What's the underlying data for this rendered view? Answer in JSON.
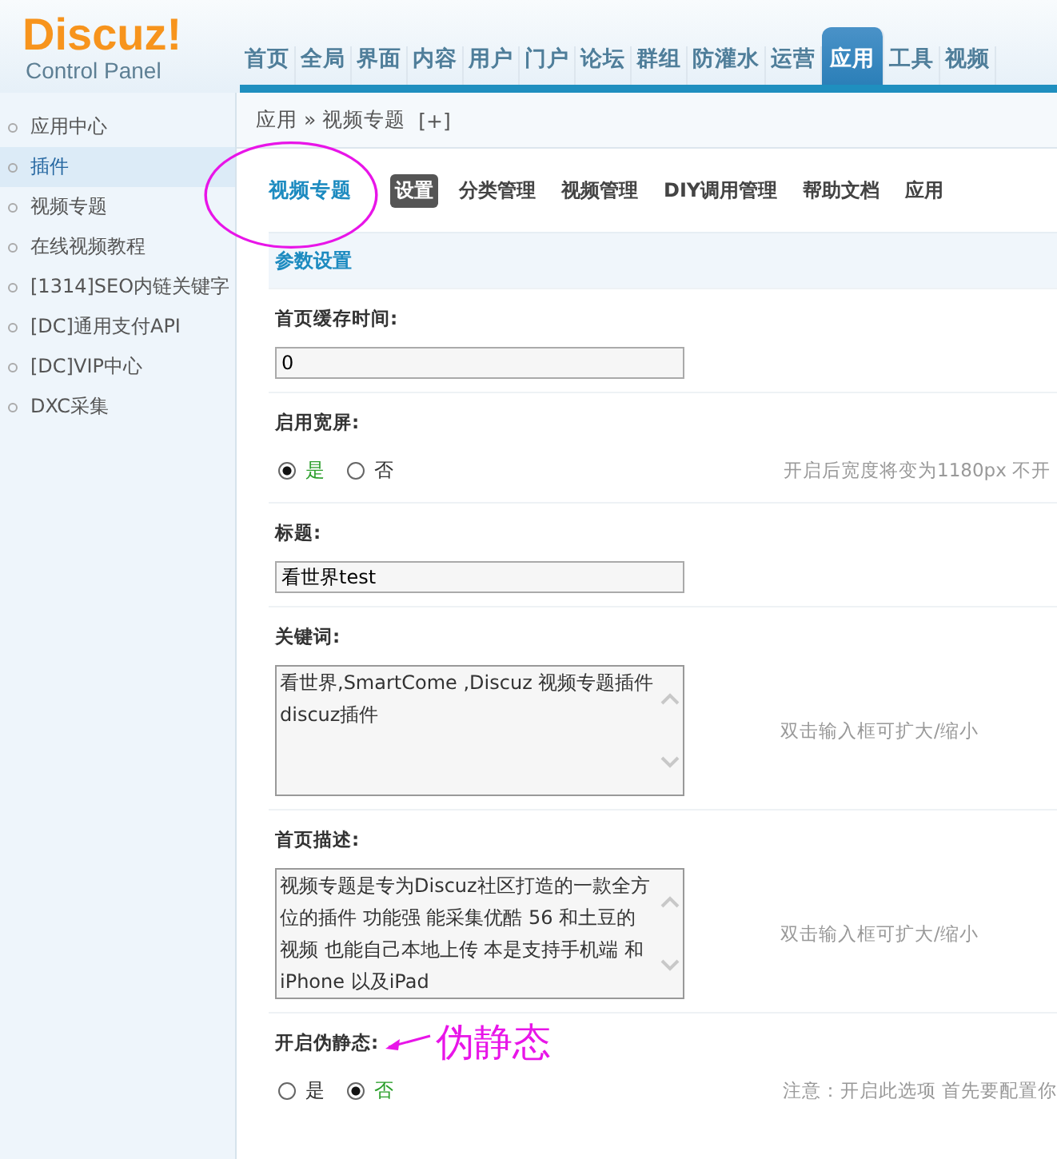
{
  "logo": {
    "title": "Discuz!",
    "subtitle": "Control Panel"
  },
  "nav": [
    {
      "label": "首页",
      "selected": false
    },
    {
      "label": "全局",
      "selected": false
    },
    {
      "label": "界面",
      "selected": false
    },
    {
      "label": "内容",
      "selected": false
    },
    {
      "label": "用户",
      "selected": false
    },
    {
      "label": "门户",
      "selected": false
    },
    {
      "label": "论坛",
      "selected": false
    },
    {
      "label": "群组",
      "selected": false
    },
    {
      "label": "防灌水",
      "selected": false
    },
    {
      "label": "运营",
      "selected": false
    },
    {
      "label": "应用",
      "selected": true
    },
    {
      "label": "工具",
      "selected": false
    },
    {
      "label": "视频",
      "selected": false
    }
  ],
  "breadcrumb": {
    "path": "应用 » 视频专题",
    "add": "[+]"
  },
  "sidebar": {
    "items": [
      {
        "label": "应用中心",
        "selected": false
      },
      {
        "label": "插件",
        "selected": true
      },
      {
        "label": "视频专题",
        "selected": false
      },
      {
        "label": "在线视频教程",
        "selected": false
      },
      {
        "label": "[1314]SEO内链关键字",
        "selected": false
      },
      {
        "label": "[DC]通用支付API",
        "selected": false
      },
      {
        "label": "[DC]VIP中心",
        "selected": false
      },
      {
        "label": "DXC采集",
        "selected": false
      }
    ]
  },
  "plugin_title": "视频专题",
  "tabs": [
    {
      "label": "设置",
      "selected": true
    },
    {
      "label": "分类管理",
      "selected": false
    },
    {
      "label": "视频管理",
      "selected": false
    },
    {
      "label": "DIY调用管理",
      "selected": false
    },
    {
      "label": "帮助文档",
      "selected": false
    },
    {
      "label": "应用",
      "selected": false
    }
  ],
  "section": "参数设置",
  "fields": [
    {
      "kind": "text",
      "label": "首页缓存时间:",
      "value": "0"
    },
    {
      "kind": "radio",
      "label": "启用宽屏:",
      "options": [
        {
          "label": "是",
          "selected": true
        },
        {
          "label": "否",
          "selected": false
        }
      ],
      "hint": "开启后宽度将变为1180px 不开"
    },
    {
      "kind": "text",
      "label": "标题:",
      "value": "看世界test"
    },
    {
      "kind": "textarea",
      "label": "关键词:",
      "value": "看世界,SmartCome ,Discuz 视频专题插件 discuz插件",
      "hint": "双击输入框可扩大/缩小"
    },
    {
      "kind": "textarea",
      "label": "首页描述:",
      "value": "视频专题是专为Discuz社区打造的一款全方位的插件 功能强 能采集优酷 56 和土豆的视频 也能自己本地上传 本是支持手机端 和iPhone 以及iPad",
      "hint": "双击输入框可扩大/缩小"
    },
    {
      "kind": "radio",
      "label": "开启伪静态:",
      "note": "伪静态",
      "options": [
        {
          "label": "是",
          "selected": false
        },
        {
          "label": "否",
          "selected": true
        }
      ],
      "hint": "注意：开启此选项 首先要配置你"
    }
  ]
}
